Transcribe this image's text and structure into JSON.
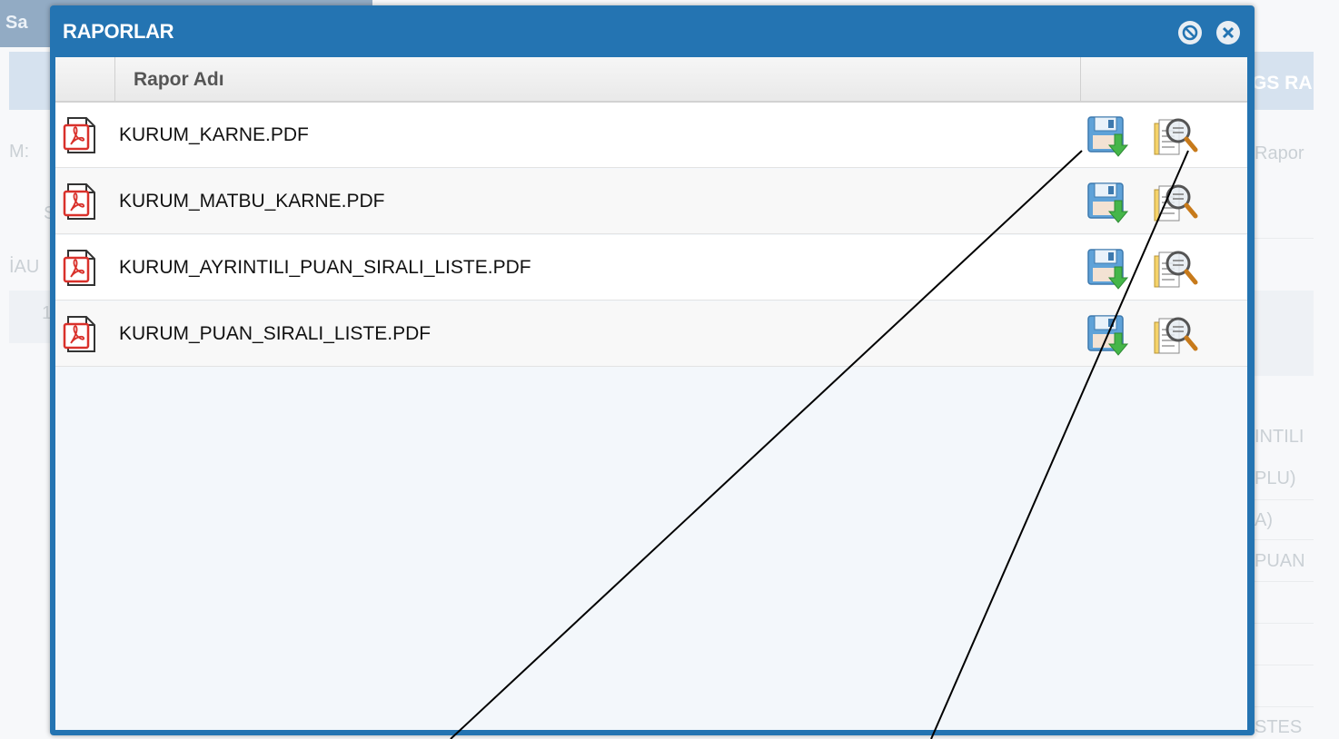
{
  "background": {
    "topbar_text": "Sa",
    "right_header_text": "GS RA",
    "left_fragments": [
      "M:",
      "İAU",
      "1",
      "S"
    ],
    "right_fragments": [
      "Rapor",
      "INTILI",
      "PLU)",
      "A)",
      "PUAN",
      "STES"
    ]
  },
  "dialog": {
    "title": "RAPORLAR",
    "minimize_button_icon": "minimize-circle-icon",
    "close_button_icon": "close-circle-icon",
    "column_header": "Rapor Adı",
    "rows": [
      {
        "file_name": "KURUM_KARNE.PDF",
        "file_icon": "pdf-file-icon",
        "download_icon": "save-download-icon",
        "preview_icon": "document-magnifier-icon"
      },
      {
        "file_name": "KURUM_MATBU_KARNE.PDF",
        "file_icon": "pdf-file-icon",
        "download_icon": "save-download-icon",
        "preview_icon": "document-magnifier-icon"
      },
      {
        "file_name": "KURUM_AYRINTILI_PUAN_SIRALI_LISTE.PDF",
        "file_icon": "pdf-file-icon",
        "download_icon": "save-download-icon",
        "preview_icon": "document-magnifier-icon"
      },
      {
        "file_name": "KURUM_PUAN_SIRALI_LISTE.PDF",
        "file_icon": "pdf-file-icon",
        "download_icon": "save-download-icon",
        "preview_icon": "document-magnifier-icon"
      }
    ]
  },
  "colors": {
    "dialog_titlebar": "#2474b2",
    "pdf_icon_red": "#d9312b",
    "annotation_lines": "#000000"
  }
}
